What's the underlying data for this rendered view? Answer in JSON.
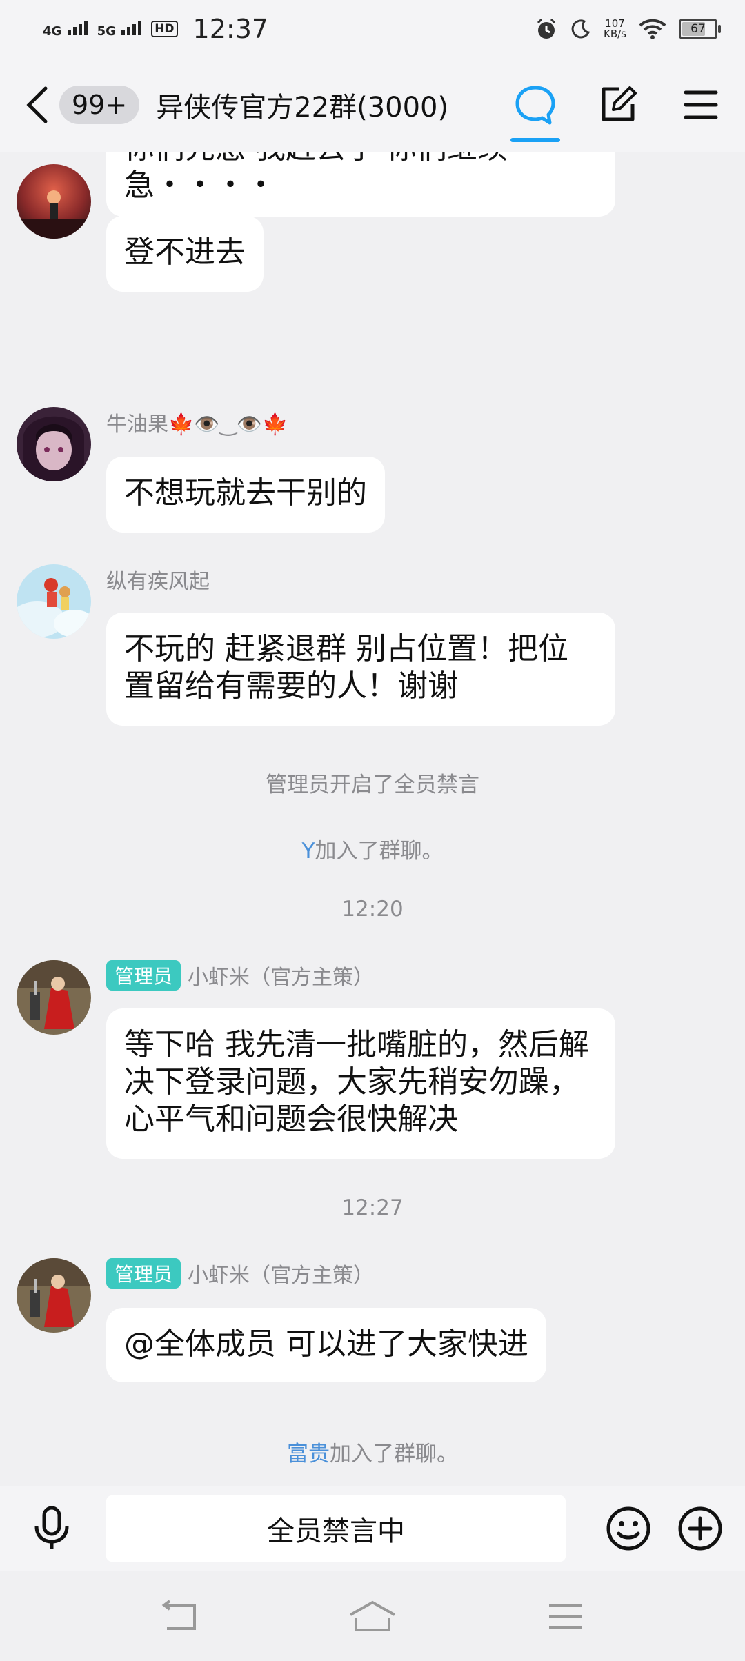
{
  "status": {
    "net1": "4G",
    "net2": "5G",
    "hd": "HD",
    "time": "12:37",
    "speed_value": "107",
    "speed_unit": "KB/s",
    "battery": "67"
  },
  "header": {
    "unread": "99+",
    "title": "异侠传官方22群(3000)",
    "accent": "#1aa1f5"
  },
  "messages": [
    {
      "text": "你们先急 我赶去了 你们继续急・・・・"
    },
    {
      "text": "登不进去"
    },
    {
      "sender": "牛油果🍁👁️‿👁️🍁",
      "text": "不想玩就去干别的"
    },
    {
      "sender": "纵有疾风起",
      "text": "不玩的 赶紧退群 别占位置！把位置留给有需要的人！谢谢"
    },
    {
      "role": "管理员",
      "sender": "小虾米（官方主策）",
      "text": "等下哈 我先清一批嘴脏的，然后解决下登录问题，大家先稍安勿躁，心平气和问题会很快解决"
    },
    {
      "role": "管理员",
      "sender": "小虾米（官方主策）",
      "text": "@全体成员 可以进了大家快进"
    }
  ],
  "system": {
    "mute_all": "管理员开启了全员禁言",
    "join1_name": "Y",
    "join1_text": "加入了群聊。",
    "time1": "12:20",
    "time2": "12:27",
    "join2_name": "富贵",
    "join2_text": "加入了群聊。"
  },
  "input": {
    "muted_text": "全员禁言中"
  },
  "icons": {
    "back": "chevron-left-icon",
    "chat": "chat-bubble-icon",
    "edit": "edit-icon",
    "menu": "menu-icon",
    "mic": "mic-icon",
    "emoji": "emoji-icon",
    "plus": "plus-icon",
    "nav_back": "nav-back-icon",
    "nav_home": "nav-home-icon",
    "nav_menu": "nav-menu-icon"
  }
}
